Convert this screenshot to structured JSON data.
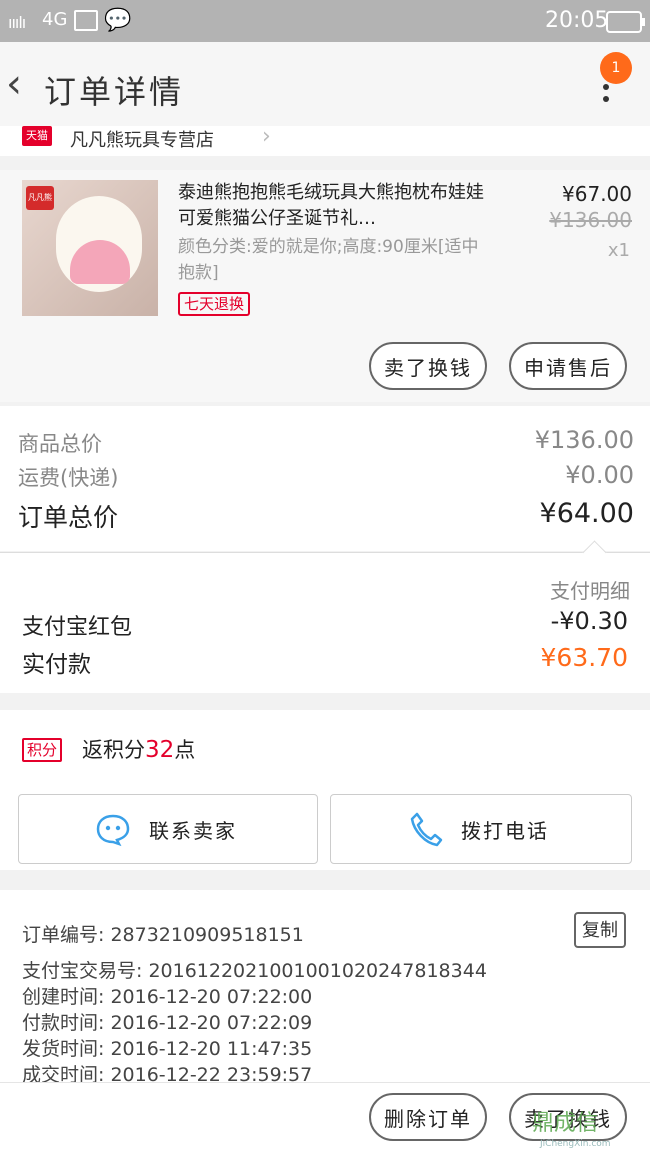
{
  "status_bar": {
    "signal": "ııılı",
    "network": "4G",
    "time": "20:05"
  },
  "header": {
    "title": "订单详情",
    "badge": "1"
  },
  "store": {
    "platform": "天猫",
    "name": "凡凡熊玩具专营店"
  },
  "product": {
    "brand_tag": "凡凡熊",
    "title": "泰迪熊抱抱熊毛绒玩具大熊抱枕布娃娃可爱熊猫公仔圣诞节礼…",
    "sku": "颜色分类:爱的就是你;高度:90厘米[适中抱款]",
    "service_tag": "七天退换",
    "price": "¥67.00",
    "original_price": "¥136.00",
    "quantity": "x1",
    "buttons": {
      "cash_swap": "卖了换钱",
      "after_sale": "申请售后"
    }
  },
  "summary": {
    "goods_total_label": "商品总价",
    "goods_total": "¥136.00",
    "shipping_label": "运费(快递)",
    "shipping": "¥0.00",
    "order_total_label": "订单总价",
    "order_total": "¥64.00"
  },
  "payment": {
    "detail_link": "支付明细",
    "redpacket_label": "支付宝红包",
    "redpacket": "-¥0.30",
    "paid_label": "实付款",
    "paid": "¥63.70"
  },
  "points": {
    "badge": "积分",
    "prefix": "返积分",
    "value": "32",
    "suffix": "点"
  },
  "contact": {
    "seller": "联系卖家",
    "call": "拨打电话"
  },
  "order_info": {
    "order_no": "订单编号: 2873210909518151",
    "copy": "复制",
    "alipay_no": "支付宝交易号: 2016122021001001020247818344",
    "created": "创建时间: 2016-12-20 07:22:00",
    "paid": "付款时间: 2016-12-20 07:22:09",
    "shipped": "发货时间: 2016-12-20 11:47:35",
    "done": "成交时间: 2016-12-22 23:59:57"
  },
  "footer": {
    "delete": "删除订单",
    "swap": "卖了换钱"
  },
  "watermark": {
    "brand": "鼎成信",
    "url": "JiChengXin.com"
  },
  "colors": {
    "accent": "#ff6a1a",
    "tmall_red": "#e4002b",
    "contact_blue": "#3aa0e8"
  }
}
